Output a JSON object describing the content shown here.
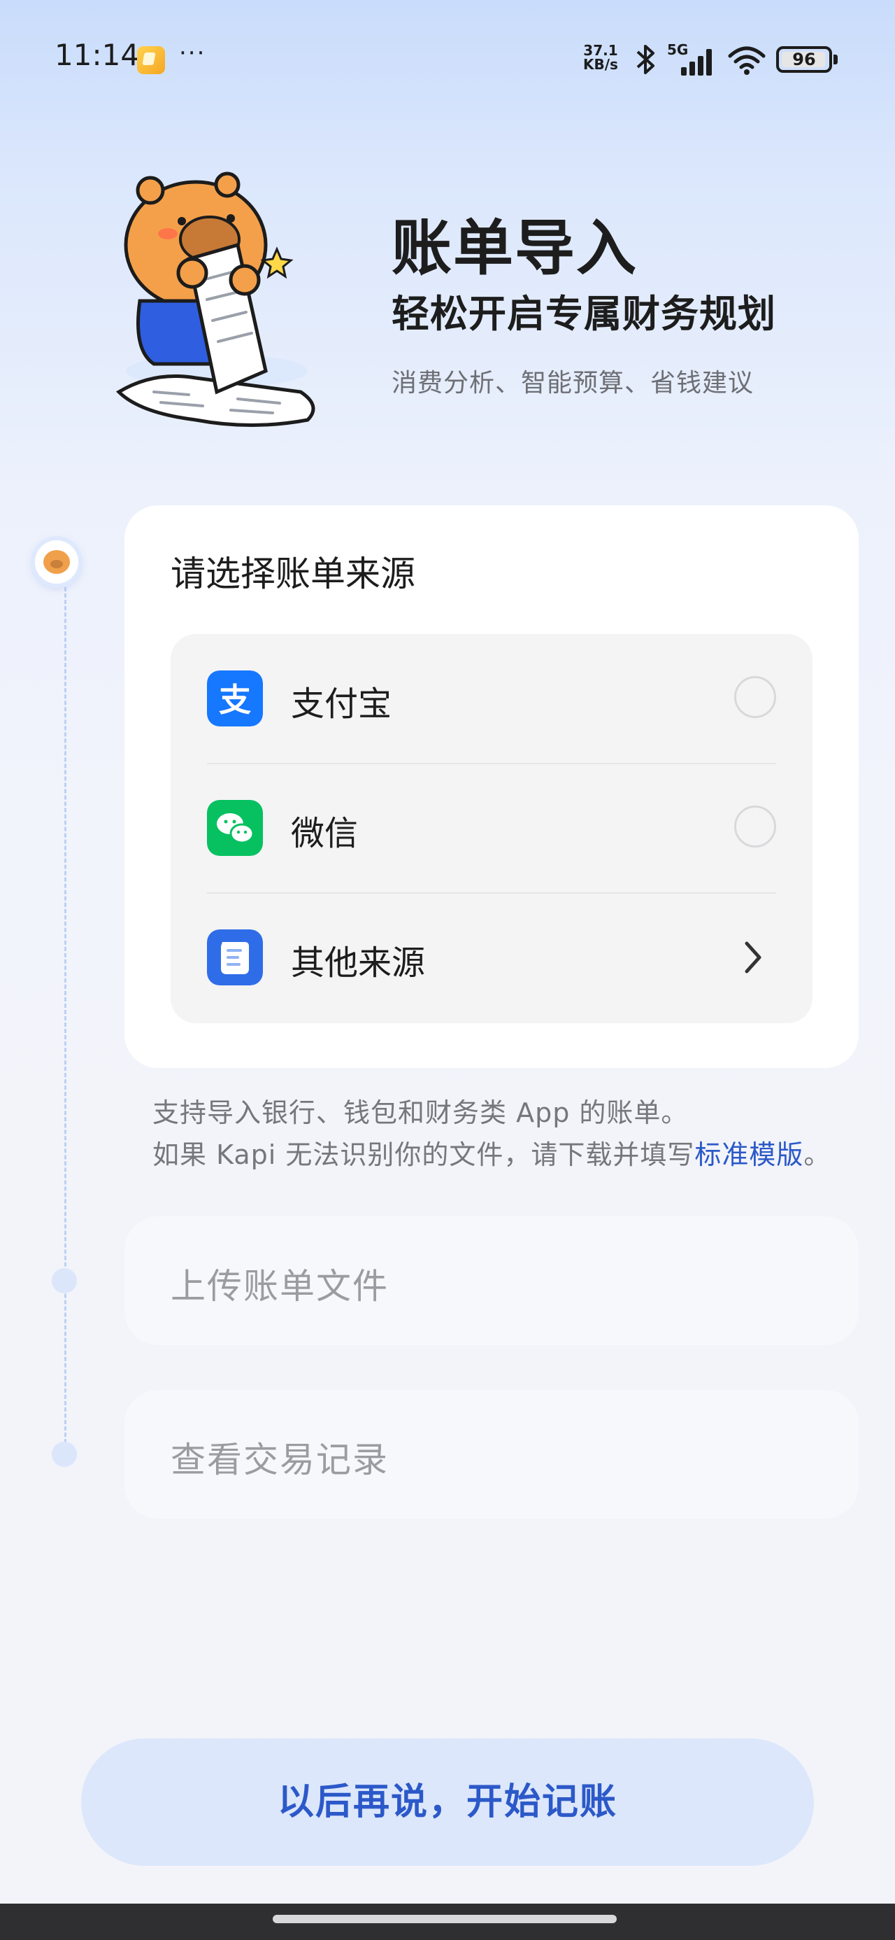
{
  "status_bar": {
    "time": "11:14",
    "more": "···",
    "net_speed_value": "37.1",
    "net_speed_unit": "KB/s",
    "network_type": "5G",
    "battery": "96"
  },
  "header": {
    "title": "账单导入",
    "subtitle": "轻松开启专属财务规划",
    "features": "消费分析、智能预算、省钱建议"
  },
  "source_card": {
    "title": "请选择账单来源",
    "options": [
      {
        "label": "支付宝",
        "icon": "alipay-icon",
        "color": "#1677ff"
      },
      {
        "label": "微信",
        "icon": "wechat-icon",
        "color": "#07c160"
      },
      {
        "label": "其他来源",
        "icon": "receipt-icon",
        "color": "#2f6de8"
      }
    ]
  },
  "note": {
    "line1": "支持导入银行、钱包和财务类 App 的账单。",
    "line2_prefix": "如果 Kapi 无法识别你的文件，请下载并填写",
    "line2_link": "标准模版",
    "line2_suffix": "。"
  },
  "steps": {
    "upload": "上传账单文件",
    "records": "查看交易记录"
  },
  "later_button": "以后再说，开始记账",
  "colors": {
    "accent": "#2c59c9",
    "button_bg": "#dce7fb"
  }
}
